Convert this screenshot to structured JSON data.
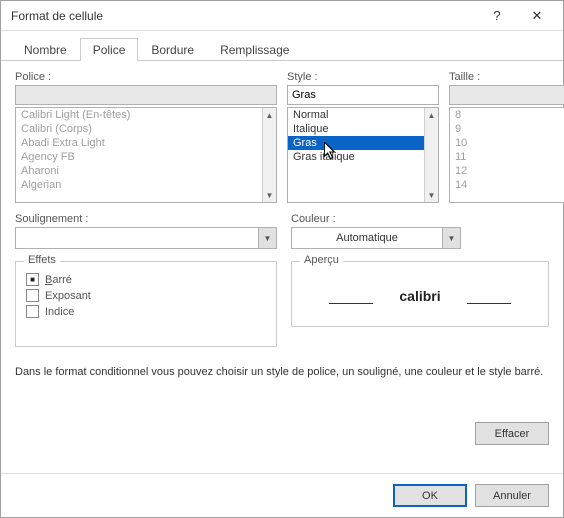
{
  "title": "Format de cellule",
  "sysbuttons": {
    "help": "?",
    "close": "✕"
  },
  "tabs": {
    "nombre": "Nombre",
    "police": "Police",
    "bordure": "Bordure",
    "remplissage": "Remplissage"
  },
  "labels": {
    "police": "Police :",
    "style": "Style :",
    "taille": "Taille :",
    "soulignement": "Soulignement :",
    "couleur": "Couleur :",
    "effets": "Effets",
    "apercu": "Aperçu"
  },
  "police_input": "",
  "police_items": [
    "Calibri Light (En-têtes)",
    "Calibri (Corps)",
    "Abadi Extra Light",
    "Agency FB",
    "Aharoni",
    "Algerian"
  ],
  "style_input": "Gras",
  "style_items": [
    "Normal",
    "Italique",
    "Gras",
    "Gras italique"
  ],
  "style_selected_index": 2,
  "taille_input": "",
  "taille_items": [
    "8",
    "9",
    "10",
    "11",
    "12",
    "14"
  ],
  "soulignement_value": "",
  "couleur_value": "Automatique",
  "effets": {
    "barre_label_u": "B",
    "barre_label_rest": "arré",
    "barre_checked": true,
    "exposant": "Exposant",
    "exposant_checked": false,
    "indice": "Indice",
    "indice_checked": false
  },
  "preview_text": "calibri",
  "note": "Dans le format conditionnel vous pouvez choisir un style de police, un souligné, une couleur et le style barré.",
  "buttons": {
    "effacer": "Effacer",
    "ok": "OK",
    "annuler": "Annuler"
  }
}
